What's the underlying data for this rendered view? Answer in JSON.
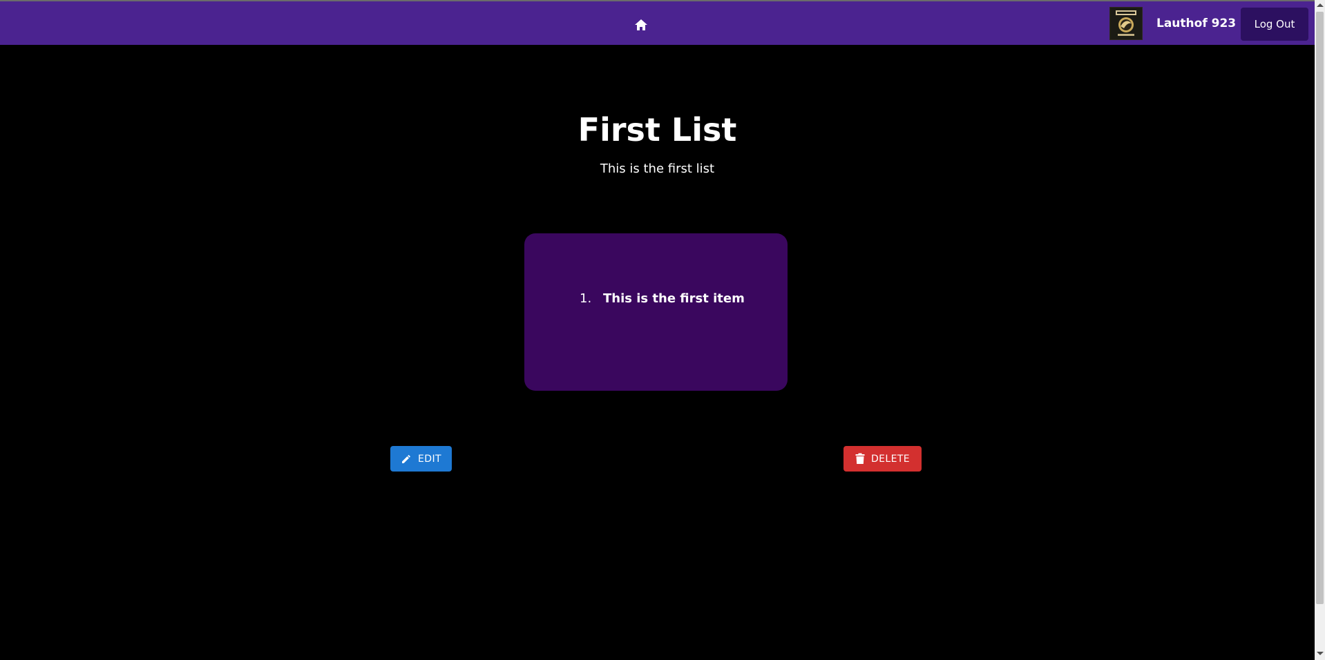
{
  "navbar": {
    "home_icon": "home-icon",
    "avatar_icon": "user-avatar-image",
    "username": "Lauthof 923",
    "logout_label": "Log Out",
    "background": "#4b2390"
  },
  "list": {
    "title": "First List",
    "description": "This is the first list",
    "items": [
      {
        "number": "1.",
        "text": "This is the first item"
      }
    ],
    "card_color": "#3a075e"
  },
  "actions": {
    "edit_label": "EDIT",
    "edit_icon": "pencil-icon",
    "edit_color": "#1e79d3",
    "delete_label": "DELETE",
    "delete_icon": "trash-icon",
    "delete_color": "#d3302f"
  }
}
